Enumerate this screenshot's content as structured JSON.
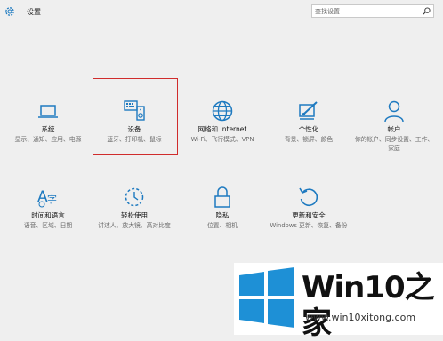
{
  "window": {
    "title": "设置"
  },
  "search": {
    "placeholder": "查找设置"
  },
  "categories": [
    {
      "name": "系统",
      "desc": "显示、通知、应用、电源",
      "icon": "laptop-icon"
    },
    {
      "name": "设备",
      "desc": "蓝牙、打印机、鼠标",
      "icon": "devices-icon"
    },
    {
      "name": "网络和 Internet",
      "desc": "Wi-Fi、飞行模式、VPN",
      "icon": "globe-icon"
    },
    {
      "name": "个性化",
      "desc": "背景、锁屏、颜色",
      "icon": "paintbrush-icon"
    },
    {
      "name": "帐户",
      "desc": "你的帐户、同步设置、工作、家庭",
      "icon": "person-icon"
    },
    {
      "name": "时间和语言",
      "desc": "语音、区域、日期",
      "icon": "time-language-icon"
    },
    {
      "name": "轻松使用",
      "desc": "讲述人、放大镜、高对比度",
      "icon": "ease-of-access-icon"
    },
    {
      "name": "隐私",
      "desc": "位置、相机",
      "icon": "lock-icon"
    },
    {
      "name": "更新和安全",
      "desc": "Windows 更新、恢复、备份",
      "icon": "update-icon"
    }
  ],
  "watermark": {
    "brand": "Win10之家",
    "url": "www.win10xitong.com"
  },
  "colors": {
    "accent": "#1e7ac0",
    "highlight": "#d02c2c",
    "logo_blue": "#1e90d6"
  }
}
